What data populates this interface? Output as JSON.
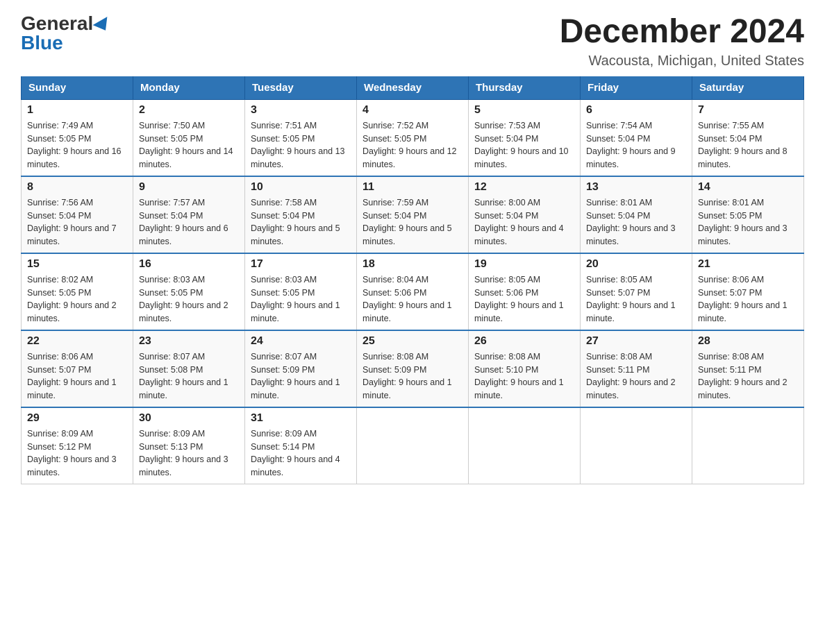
{
  "logo": {
    "general": "General",
    "blue": "Blue"
  },
  "title": "December 2024",
  "location": "Wacousta, Michigan, United States",
  "days_of_week": [
    "Sunday",
    "Monday",
    "Tuesday",
    "Wednesday",
    "Thursday",
    "Friday",
    "Saturday"
  ],
  "weeks": [
    [
      {
        "day": "1",
        "sunrise": "7:49 AM",
        "sunset": "5:05 PM",
        "daylight": "9 hours and 16 minutes."
      },
      {
        "day": "2",
        "sunrise": "7:50 AM",
        "sunset": "5:05 PM",
        "daylight": "9 hours and 14 minutes."
      },
      {
        "day": "3",
        "sunrise": "7:51 AM",
        "sunset": "5:05 PM",
        "daylight": "9 hours and 13 minutes."
      },
      {
        "day": "4",
        "sunrise": "7:52 AM",
        "sunset": "5:05 PM",
        "daylight": "9 hours and 12 minutes."
      },
      {
        "day": "5",
        "sunrise": "7:53 AM",
        "sunset": "5:04 PM",
        "daylight": "9 hours and 10 minutes."
      },
      {
        "day": "6",
        "sunrise": "7:54 AM",
        "sunset": "5:04 PM",
        "daylight": "9 hours and 9 minutes."
      },
      {
        "day": "7",
        "sunrise": "7:55 AM",
        "sunset": "5:04 PM",
        "daylight": "9 hours and 8 minutes."
      }
    ],
    [
      {
        "day": "8",
        "sunrise": "7:56 AM",
        "sunset": "5:04 PM",
        "daylight": "9 hours and 7 minutes."
      },
      {
        "day": "9",
        "sunrise": "7:57 AM",
        "sunset": "5:04 PM",
        "daylight": "9 hours and 6 minutes."
      },
      {
        "day": "10",
        "sunrise": "7:58 AM",
        "sunset": "5:04 PM",
        "daylight": "9 hours and 5 minutes."
      },
      {
        "day": "11",
        "sunrise": "7:59 AM",
        "sunset": "5:04 PM",
        "daylight": "9 hours and 5 minutes."
      },
      {
        "day": "12",
        "sunrise": "8:00 AM",
        "sunset": "5:04 PM",
        "daylight": "9 hours and 4 minutes."
      },
      {
        "day": "13",
        "sunrise": "8:01 AM",
        "sunset": "5:04 PM",
        "daylight": "9 hours and 3 minutes."
      },
      {
        "day": "14",
        "sunrise": "8:01 AM",
        "sunset": "5:05 PM",
        "daylight": "9 hours and 3 minutes."
      }
    ],
    [
      {
        "day": "15",
        "sunrise": "8:02 AM",
        "sunset": "5:05 PM",
        "daylight": "9 hours and 2 minutes."
      },
      {
        "day": "16",
        "sunrise": "8:03 AM",
        "sunset": "5:05 PM",
        "daylight": "9 hours and 2 minutes."
      },
      {
        "day": "17",
        "sunrise": "8:03 AM",
        "sunset": "5:05 PM",
        "daylight": "9 hours and 1 minute."
      },
      {
        "day": "18",
        "sunrise": "8:04 AM",
        "sunset": "5:06 PM",
        "daylight": "9 hours and 1 minute."
      },
      {
        "day": "19",
        "sunrise": "8:05 AM",
        "sunset": "5:06 PM",
        "daylight": "9 hours and 1 minute."
      },
      {
        "day": "20",
        "sunrise": "8:05 AM",
        "sunset": "5:07 PM",
        "daylight": "9 hours and 1 minute."
      },
      {
        "day": "21",
        "sunrise": "8:06 AM",
        "sunset": "5:07 PM",
        "daylight": "9 hours and 1 minute."
      }
    ],
    [
      {
        "day": "22",
        "sunrise": "8:06 AM",
        "sunset": "5:07 PM",
        "daylight": "9 hours and 1 minute."
      },
      {
        "day": "23",
        "sunrise": "8:07 AM",
        "sunset": "5:08 PM",
        "daylight": "9 hours and 1 minute."
      },
      {
        "day": "24",
        "sunrise": "8:07 AM",
        "sunset": "5:09 PM",
        "daylight": "9 hours and 1 minute."
      },
      {
        "day": "25",
        "sunrise": "8:08 AM",
        "sunset": "5:09 PM",
        "daylight": "9 hours and 1 minute."
      },
      {
        "day": "26",
        "sunrise": "8:08 AM",
        "sunset": "5:10 PM",
        "daylight": "9 hours and 1 minute."
      },
      {
        "day": "27",
        "sunrise": "8:08 AM",
        "sunset": "5:11 PM",
        "daylight": "9 hours and 2 minutes."
      },
      {
        "day": "28",
        "sunrise": "8:08 AM",
        "sunset": "5:11 PM",
        "daylight": "9 hours and 2 minutes."
      }
    ],
    [
      {
        "day": "29",
        "sunrise": "8:09 AM",
        "sunset": "5:12 PM",
        "daylight": "9 hours and 3 minutes."
      },
      {
        "day": "30",
        "sunrise": "8:09 AM",
        "sunset": "5:13 PM",
        "daylight": "9 hours and 3 minutes."
      },
      {
        "day": "31",
        "sunrise": "8:09 AM",
        "sunset": "5:14 PM",
        "daylight": "9 hours and 4 minutes."
      },
      null,
      null,
      null,
      null
    ]
  ]
}
